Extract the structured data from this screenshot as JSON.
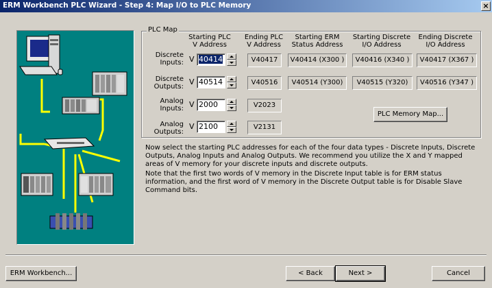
{
  "window": {
    "title": "ERM Workbench PLC Wizard - Step 4: Map I/O to PLC Memory",
    "close_glyph": "×"
  },
  "plc_map": {
    "group_label": "PLC Map",
    "headers": {
      "start_plc": "Starting PLC\nV Address",
      "end_plc": "Ending PLC\nV Address",
      "start_erm": "Starting ERM\nStatus Address",
      "start_discrete": "Starting Discrete\nI/O Address",
      "end_discrete": "Ending Discrete\nI/O Address"
    },
    "v_prefix": "V",
    "rows": [
      {
        "label": "Discrete\nInputs:",
        "start": "40414",
        "end": "V40417",
        "erm_status": "V40414 (X300 )",
        "start_io": "V40416 (X340 )",
        "end_io": "V40417 (X367 )"
      },
      {
        "label": "Discrete\nOutputs:",
        "start": "40514",
        "end": "V40516",
        "erm_status": "V40514 (Y300)",
        "start_io": "V40515 (Y320)",
        "end_io": "V40516 (Y347 )"
      },
      {
        "label": "Analog\nInputs:",
        "start": "2000",
        "end": "V2023"
      },
      {
        "label": "Analog\nOutputs:",
        "start": "2100",
        "end": "V2131"
      }
    ],
    "memory_map_button": "PLC Memory Map..."
  },
  "description": {
    "para1": "Now select the starting PLC addresses for each of the four data types - Discrete Inputs, Discrete Outputs, Analog Inputs and Analog Outputs.  We recommend you utilize the X and Y mapped areas of V memory for your discrete inputs and discrete outputs.",
    "para2": "Note that the first two words of V memory in the Discrete Input table is for ERM status information, and the first word of V memory in the Discrete Output table is for Disable Slave Command bits."
  },
  "footer": {
    "erm_workbench": "ERM Workbench...",
    "back": "< Back",
    "next": "Next >",
    "cancel": "Cancel"
  },
  "colors": {
    "illustration_bg": "#008080",
    "network_cable": "#ffff00",
    "title_bar": "#0a246a",
    "dialog_bg": "#d4d0c8"
  }
}
